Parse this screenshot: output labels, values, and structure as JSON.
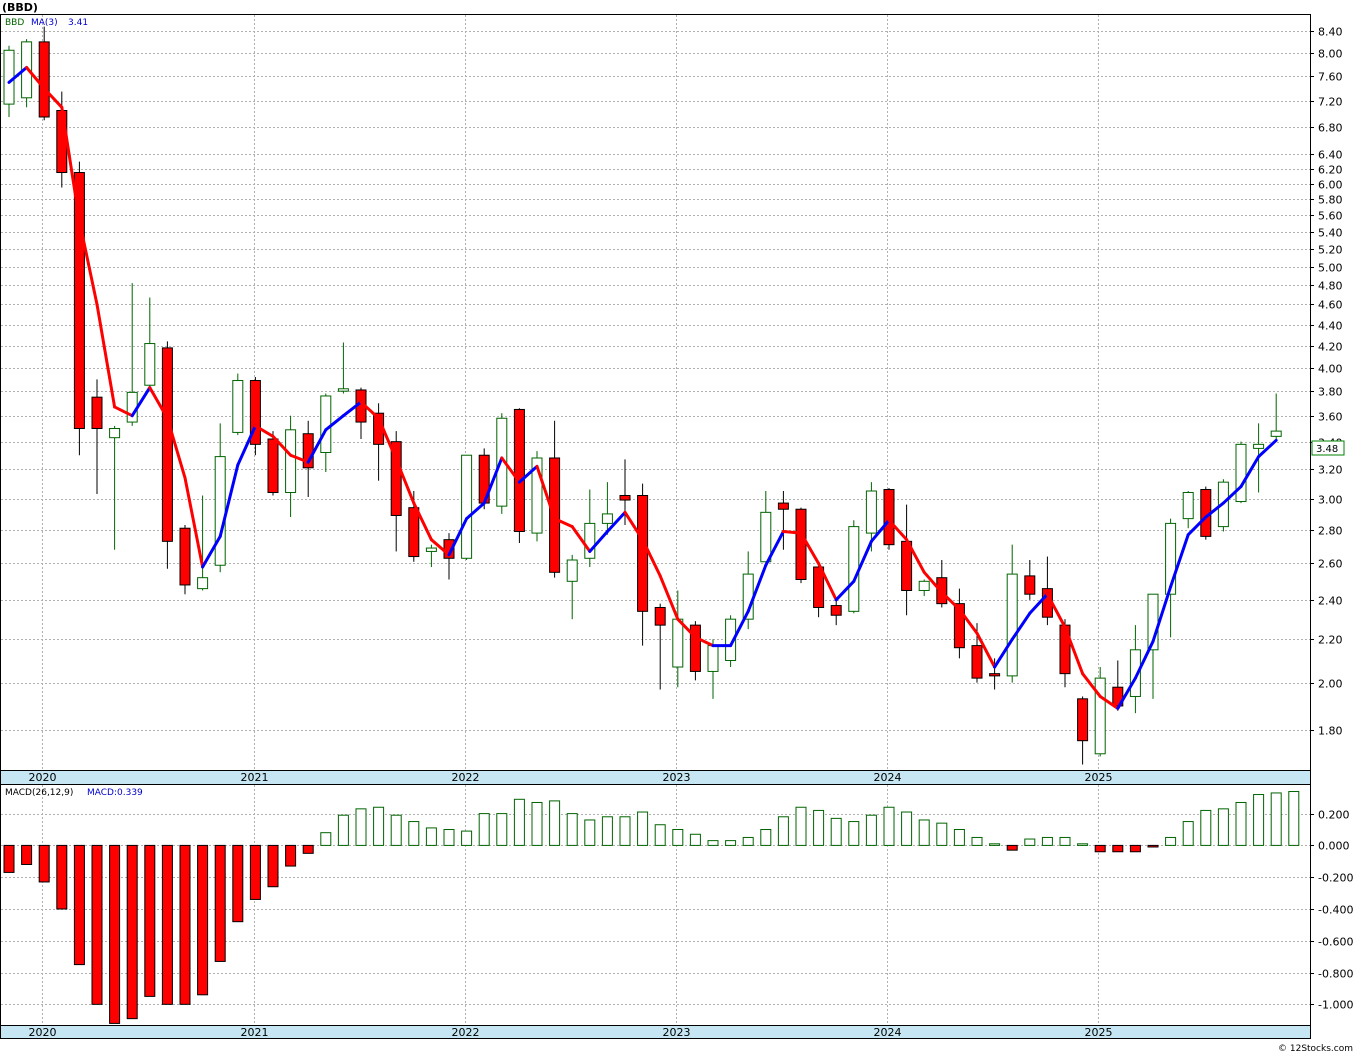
{
  "header": {
    "symbol_label": "(BBD)",
    "legend_symbol": "BBD",
    "legend_ma_label": "MA(3)",
    "legend_ma_value": "3.41",
    "macd_label": "MACD(26,12,9)",
    "macd_value_label": "MACD:0.339",
    "last_price_tag": "3.48",
    "watermark": "© 12Stocks.com"
  },
  "colors": {
    "up_candle_border": "#006400",
    "down_candle_fill": "#ff0000",
    "ma_up": "#0000ff",
    "ma_down": "#ff0000",
    "macd_pos": "#006400",
    "macd_neg": "#ff0000",
    "axis_band": "#c5e6f2",
    "price_tag_border": "#008000"
  },
  "chart_data": [
    {
      "type": "candlestick",
      "series_name": "BBD",
      "log_scale": true,
      "ylim": [
        1.65,
        8.7
      ],
      "y_ticks": [
        1.8,
        2.0,
        2.2,
        2.4,
        2.6,
        2.8,
        3.0,
        3.2,
        3.4,
        3.6,
        3.8,
        4.0,
        4.2,
        4.4,
        4.6,
        4.8,
        5.0,
        5.2,
        5.4,
        5.6,
        5.8,
        6.0,
        6.2,
        6.4,
        6.8,
        7.2,
        7.6,
        8.0,
        8.4
      ],
      "y_tick_labels": [
        "1.80",
        "2.00",
        "2.20",
        "2.40",
        "2.60",
        "2.80",
        "3.00",
        "3.20",
        "3.40",
        "3.60",
        "3.80",
        "4.00",
        "4.20",
        "4.40",
        "4.60",
        "4.80",
        "5.00",
        "5.20",
        "5.40",
        "5.60",
        "5.80",
        "6.00",
        "6.20",
        "6.40",
        "6.80",
        "7.20",
        "7.60",
        "8.00",
        "8.40"
      ],
      "x_year_labels": [
        "2020",
        "2021",
        "2022",
        "2023",
        "2024",
        "2025"
      ],
      "grid": true,
      "candles": [
        {
          "date": "2020-01",
          "open": 7.15,
          "high": 8.13,
          "low": 6.95,
          "close": 8.05
        },
        {
          "date": "2020-02",
          "open": 7.25,
          "high": 8.25,
          "low": 7.1,
          "close": 8.2
        },
        {
          "date": "2020-03",
          "open": 8.2,
          "high": 8.48,
          "low": 6.9,
          "close": 6.95
        },
        {
          "date": "2020-04",
          "open": 7.05,
          "high": 7.35,
          "low": 5.95,
          "close": 6.15
        },
        {
          "date": "2020-05",
          "open": 6.15,
          "high": 6.3,
          "low": 3.3,
          "close": 3.5
        },
        {
          "date": "2020-06",
          "open": 3.75,
          "high": 3.9,
          "low": 3.03,
          "close": 3.5
        },
        {
          "date": "2020-07",
          "open": 3.43,
          "high": 3.52,
          "low": 2.68,
          "close": 3.5
        },
        {
          "date": "2020-08",
          "open": 3.55,
          "high": 4.82,
          "low": 3.52,
          "close": 3.79
        },
        {
          "date": "2020-09",
          "open": 3.85,
          "high": 4.67,
          "low": 3.82,
          "close": 4.22
        },
        {
          "date": "2020-10",
          "open": 4.18,
          "high": 4.24,
          "low": 2.57,
          "close": 2.73
        },
        {
          "date": "2020-11",
          "open": 2.81,
          "high": 2.83,
          "low": 2.43,
          "close": 2.48
        },
        {
          "date": "2020-12",
          "open": 2.46,
          "high": 3.02,
          "low": 2.45,
          "close": 2.52
        },
        {
          "date": "2021-01",
          "open": 2.59,
          "high": 3.54,
          "low": 2.55,
          "close": 3.29
        },
        {
          "date": "2021-02",
          "open": 3.47,
          "high": 3.95,
          "low": 3.45,
          "close": 3.89
        },
        {
          "date": "2021-03",
          "open": 3.89,
          "high": 3.92,
          "low": 3.3,
          "close": 3.38
        },
        {
          "date": "2021-04",
          "open": 3.42,
          "high": 3.48,
          "low": 3.02,
          "close": 3.04
        },
        {
          "date": "2021-05",
          "open": 3.04,
          "high": 3.6,
          "low": 2.88,
          "close": 3.49
        },
        {
          "date": "2021-06",
          "open": 3.46,
          "high": 3.56,
          "low": 3.01,
          "close": 3.21
        },
        {
          "date": "2021-07",
          "open": 3.32,
          "high": 3.78,
          "low": 3.18,
          "close": 3.76
        },
        {
          "date": "2021-08",
          "open": 3.8,
          "high": 4.23,
          "low": 3.78,
          "close": 3.82
        },
        {
          "date": "2021-09",
          "open": 3.81,
          "high": 3.83,
          "low": 3.42,
          "close": 3.55
        },
        {
          "date": "2021-10",
          "open": 3.62,
          "high": 3.7,
          "low": 3.12,
          "close": 3.38
        },
        {
          "date": "2021-11",
          "open": 3.4,
          "high": 3.48,
          "low": 2.67,
          "close": 2.89
        },
        {
          "date": "2021-12",
          "open": 2.94,
          "high": 3.05,
          "low": 2.61,
          "close": 2.64
        },
        {
          "date": "2022-01",
          "open": 2.67,
          "high": 2.71,
          "low": 2.58,
          "close": 2.69
        },
        {
          "date": "2022-02",
          "open": 2.74,
          "high": 2.78,
          "low": 2.51,
          "close": 2.63
        },
        {
          "date": "2022-03",
          "open": 2.63,
          "high": 3.3,
          "low": 2.62,
          "close": 3.3
        },
        {
          "date": "2022-04",
          "open": 3.3,
          "high": 3.35,
          "low": 2.93,
          "close": 2.97
        },
        {
          "date": "2022-05",
          "open": 2.95,
          "high": 3.62,
          "low": 2.9,
          "close": 3.58
        },
        {
          "date": "2022-06",
          "open": 3.65,
          "high": 3.66,
          "low": 2.72,
          "close": 2.79
        },
        {
          "date": "2022-07",
          "open": 2.78,
          "high": 3.33,
          "low": 2.73,
          "close": 3.28
        },
        {
          "date": "2022-08",
          "open": 3.28,
          "high": 3.56,
          "low": 2.52,
          "close": 2.55
        },
        {
          "date": "2022-09",
          "open": 2.5,
          "high": 2.65,
          "low": 2.3,
          "close": 2.62
        },
        {
          "date": "2022-10",
          "open": 2.63,
          "high": 3.06,
          "low": 2.58,
          "close": 2.84
        },
        {
          "date": "2022-11",
          "open": 2.84,
          "high": 3.11,
          "low": 2.77,
          "close": 2.9
        },
        {
          "date": "2022-12",
          "open": 3.02,
          "high": 3.27,
          "low": 2.83,
          "close": 2.99
        },
        {
          "date": "2023-01",
          "open": 3.02,
          "high": 3.1,
          "low": 2.17,
          "close": 2.34
        },
        {
          "date": "2023-02",
          "open": 2.36,
          "high": 2.38,
          "low": 1.97,
          "close": 2.27
        },
        {
          "date": "2023-03",
          "open": 2.07,
          "high": 2.45,
          "low": 1.98,
          "close": 2.3
        },
        {
          "date": "2023-04",
          "open": 2.27,
          "high": 2.29,
          "low": 2.01,
          "close": 2.05
        },
        {
          "date": "2023-05",
          "open": 2.05,
          "high": 2.2,
          "low": 1.93,
          "close": 2.17
        },
        {
          "date": "2023-06",
          "open": 2.1,
          "high": 2.32,
          "low": 2.07,
          "close": 2.3
        },
        {
          "date": "2023-07",
          "open": 2.3,
          "high": 2.67,
          "low": 2.25,
          "close": 2.54
        },
        {
          "date": "2023-08",
          "open": 2.61,
          "high": 3.05,
          "low": 2.6,
          "close": 2.91
        },
        {
          "date": "2023-09",
          "open": 2.97,
          "high": 3.05,
          "low": 2.68,
          "close": 2.93
        },
        {
          "date": "2023-10",
          "open": 2.93,
          "high": 2.94,
          "low": 2.49,
          "close": 2.51
        },
        {
          "date": "2023-11",
          "open": 2.58,
          "high": 2.6,
          "low": 2.31,
          "close": 2.36
        },
        {
          "date": "2023-12",
          "open": 2.37,
          "high": 2.4,
          "low": 2.27,
          "close": 2.32
        },
        {
          "date": "2024-01",
          "open": 2.34,
          "high": 2.86,
          "low": 2.33,
          "close": 2.82
        },
        {
          "date": "2024-02",
          "open": 2.78,
          "high": 3.11,
          "low": 2.67,
          "close": 3.05
        },
        {
          "date": "2024-03",
          "open": 3.06,
          "high": 3.07,
          "low": 2.68,
          "close": 2.71
        },
        {
          "date": "2024-04",
          "open": 2.73,
          "high": 2.96,
          "low": 2.32,
          "close": 2.45
        },
        {
          "date": "2024-05",
          "open": 2.45,
          "high": 2.51,
          "low": 2.42,
          "close": 2.5
        },
        {
          "date": "2024-06",
          "open": 2.52,
          "high": 2.62,
          "low": 2.36,
          "close": 2.38
        },
        {
          "date": "2024-07",
          "open": 2.38,
          "high": 2.46,
          "low": 2.11,
          "close": 2.16
        },
        {
          "date": "2024-08",
          "open": 2.17,
          "high": 2.28,
          "low": 2.0,
          "close": 2.02
        },
        {
          "date": "2024-09",
          "open": 2.04,
          "high": 2.11,
          "low": 1.97,
          "close": 2.03
        },
        {
          "date": "2024-10",
          "open": 2.03,
          "high": 2.71,
          "low": 2.0,
          "close": 2.54
        },
        {
          "date": "2024-11",
          "open": 2.53,
          "high": 2.62,
          "low": 2.4,
          "close": 2.43
        },
        {
          "date": "2024-12",
          "open": 2.46,
          "high": 2.64,
          "low": 2.27,
          "close": 2.31
        },
        {
          "date": "2025-01",
          "open": 2.27,
          "high": 2.3,
          "low": 1.98,
          "close": 2.04
        },
        {
          "date": "2025-02",
          "open": 1.93,
          "high": 1.94,
          "low": 1.67,
          "close": 1.76
        },
        {
          "date": "2025-03",
          "open": 1.71,
          "high": 2.07,
          "low": 1.7,
          "close": 2.02
        },
        {
          "date": "2025-04",
          "open": 1.98,
          "high": 2.1,
          "low": 1.88,
          "close": 1.9
        },
        {
          "date": "2025-05",
          "open": 1.94,
          "high": 2.27,
          "low": 1.87,
          "close": 2.15
        },
        {
          "date": "2025-06",
          "open": 2.15,
          "high": 2.38,
          "low": 1.93,
          "close": 2.43
        },
        {
          "date": "2025-07",
          "open": 2.43,
          "high": 2.87,
          "low": 2.21,
          "close": 2.84
        },
        {
          "date": "2025-08",
          "open": 2.87,
          "high": 3.05,
          "low": 2.81,
          "close": 3.04
        },
        {
          "date": "2025-09",
          "open": 3.06,
          "high": 3.08,
          "low": 2.74,
          "close": 2.76
        },
        {
          "date": "2025-10",
          "open": 2.82,
          "high": 3.13,
          "low": 2.79,
          "close": 3.11
        },
        {
          "date": "2025-11",
          "open": 2.98,
          "high": 3.4,
          "low": 2.97,
          "close": 3.38
        },
        {
          "date": "2025-12",
          "open": 3.35,
          "high": 3.54,
          "low": 3.04,
          "close": 3.38
        },
        {
          "date": "2026-01",
          "open": 3.44,
          "high": 3.78,
          "low": 3.4,
          "close": 3.48
        }
      ],
      "ma3": [
        7.5,
        7.75,
        7.4,
        7.1,
        5.53,
        4.6,
        3.67,
        3.6,
        3.83,
        3.58,
        3.14,
        2.58,
        2.76,
        3.23,
        3.52,
        3.44,
        3.3,
        3.25,
        3.49,
        3.6,
        3.71,
        3.58,
        3.27,
        2.97,
        2.74,
        2.65,
        2.87,
        2.97,
        3.28,
        3.11,
        3.22,
        2.87,
        2.82,
        2.67,
        2.79,
        2.91,
        2.74,
        2.53,
        2.3,
        2.21,
        2.17,
        2.17,
        2.34,
        2.59,
        2.79,
        2.78,
        2.6,
        2.4,
        2.5,
        2.73,
        2.86,
        2.74,
        2.55,
        2.44,
        2.35,
        2.23,
        2.07,
        2.2,
        2.33,
        2.43,
        2.26,
        2.04,
        1.94,
        1.89,
        2.02,
        2.19,
        2.47,
        2.77,
        2.88,
        2.97,
        3.08,
        3.29,
        3.41
      ]
    },
    {
      "type": "bar",
      "series_name": "MACD(26,12,9)",
      "ylim": [
        -1.13,
        0.38
      ],
      "y_ticks": [
        -1.0,
        -0.8,
        -0.6,
        -0.4,
        -0.2,
        0.0,
        0.2
      ],
      "y_tick_labels": [
        "-1.000",
        "-0.800",
        "-0.600",
        "-0.400",
        "-0.200",
        "0.000",
        "0.200"
      ],
      "x_year_labels": [
        "2020",
        "2021",
        "2022",
        "2023",
        "2024",
        "2025"
      ],
      "values": [
        -0.17,
        -0.12,
        -0.23,
        -0.4,
        -0.75,
        -1.0,
        -1.12,
        -1.09,
        -0.95,
        -1.0,
        -1.0,
        -0.94,
        -0.73,
        -0.48,
        -0.34,
        -0.26,
        -0.13,
        -0.05,
        0.08,
        0.19,
        0.23,
        0.24,
        0.19,
        0.15,
        0.11,
        0.1,
        0.09,
        0.2,
        0.2,
        0.29,
        0.27,
        0.28,
        0.2,
        0.16,
        0.18,
        0.18,
        0.21,
        0.13,
        0.1,
        0.07,
        0.03,
        0.03,
        0.05,
        0.1,
        0.18,
        0.24,
        0.22,
        0.17,
        0.15,
        0.19,
        0.24,
        0.21,
        0.16,
        0.14,
        0.1,
        0.05,
        0.01,
        -0.03,
        0.04,
        0.05,
        0.05,
        0.01,
        -0.04,
        -0.04,
        -0.04,
        -0.01,
        0.05,
        0.15,
        0.22,
        0.23,
        0.27,
        0.32,
        0.33,
        0.339
      ]
    }
  ]
}
